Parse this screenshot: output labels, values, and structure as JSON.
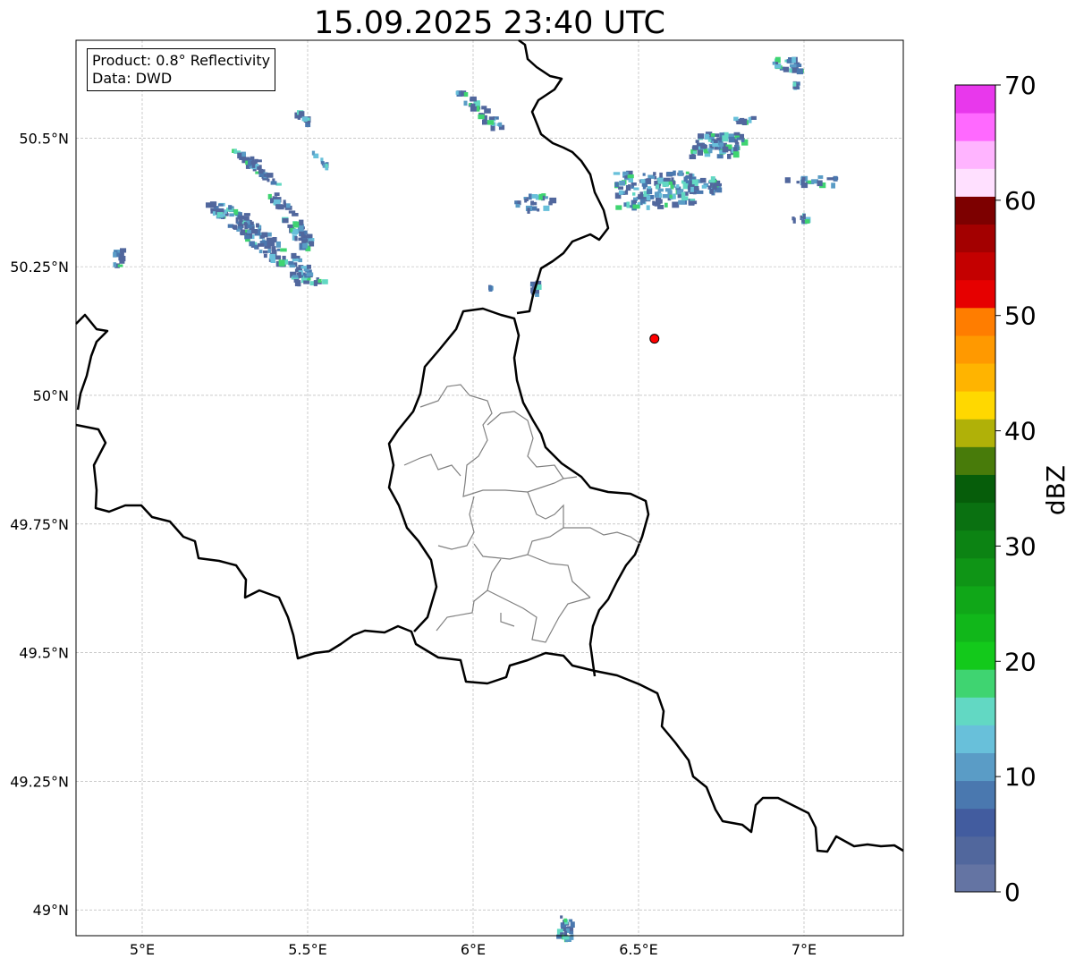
{
  "title": "15.09.2025 23:40 UTC",
  "info": {
    "product": "Product: 0.8° Reflectivity",
    "data": "Data: DWD"
  },
  "axes": {
    "lon_range": [
      4.8,
      7.3
    ],
    "lat_range": [
      48.95,
      50.69
    ],
    "lon_ticks": [
      {
        "value": 5.0,
        "label": "5°E"
      },
      {
        "value": 5.5,
        "label": "5.5°E"
      },
      {
        "value": 6.0,
        "label": "6°E"
      },
      {
        "value": 6.5,
        "label": "6.5°E"
      },
      {
        "value": 7.0,
        "label": "7°E"
      }
    ],
    "lat_ticks": [
      {
        "value": 49.0,
        "label": "49°N"
      },
      {
        "value": 49.25,
        "label": "49.25°N"
      },
      {
        "value": 49.5,
        "label": "49.5°N"
      },
      {
        "value": 49.75,
        "label": "49.75°N"
      },
      {
        "value": 50.0,
        "label": "50°N"
      },
      {
        "value": 50.25,
        "label": "50.25°N"
      },
      {
        "value": 50.5,
        "label": "50.5°N"
      }
    ],
    "grid": true
  },
  "colorbar": {
    "label": "dBZ",
    "min": 0,
    "max": 70,
    "ticks": [
      "0",
      "10",
      "20",
      "30",
      "40",
      "50",
      "60",
      "70"
    ],
    "colors": [
      "#6474a3",
      "#51679d",
      "#425c9f",
      "#4a78af",
      "#5a9cc6",
      "#68c0da",
      "#62d8c3",
      "#3fd471",
      "#13c91b",
      "#11b71a",
      "#10a718",
      "#0f9516",
      "#0c8313",
      "#0a7111",
      "#065d0a",
      "#487b0a",
      "#b0b108",
      "#ffd800",
      "#ffb400",
      "#ff9900",
      "#ff7d00",
      "#e60000",
      "#c40000",
      "#a30000",
      "#7d0000",
      "#ffe0ff",
      "#ffb4ff",
      "#ff69ff",
      "#e838ec"
    ]
  },
  "radar_site": {
    "lon": 6.548,
    "lat": 50.11,
    "color": "#ff0000"
  },
  "echo_colors": [
    "#51679d",
    "#4a78af",
    "#5a9cc6",
    "#68c0da",
    "#62d8c3",
    "#3fd471"
  ]
}
